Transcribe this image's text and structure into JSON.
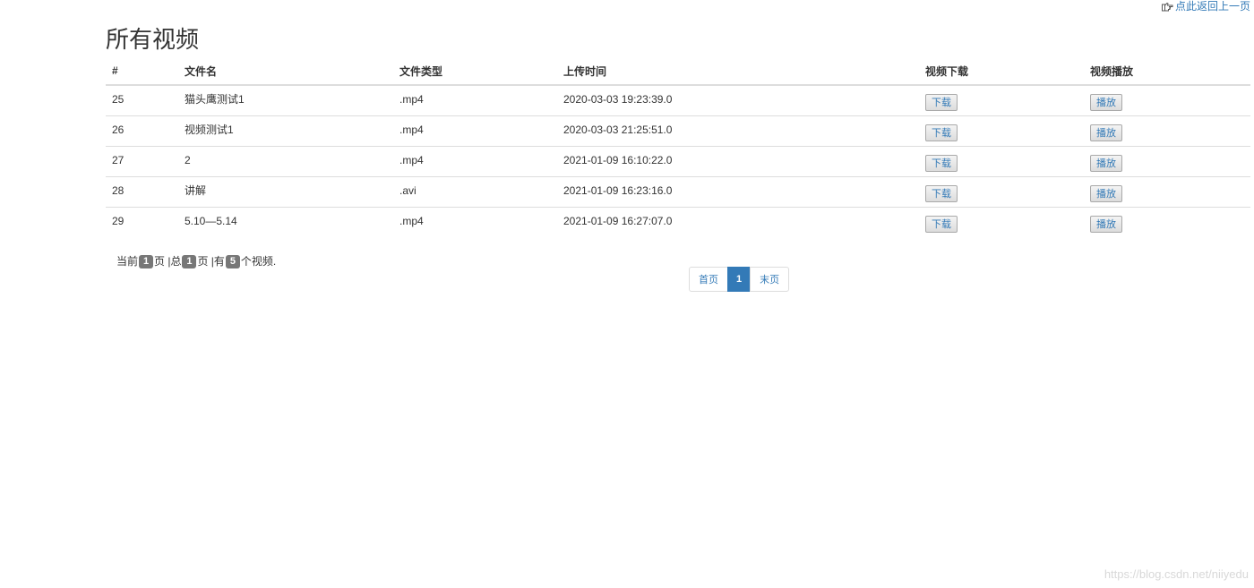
{
  "header": {
    "back_link": "点此返回上一页",
    "title": "所有视频"
  },
  "table": {
    "columns": [
      "#",
      "文件名",
      "文件类型",
      "上传时间",
      "视频下载",
      "视频播放"
    ],
    "rows": [
      {
        "id": "25",
        "name": "猫头鹰测试1",
        "type": ".mp4",
        "uploaded": "2020-03-03 19:23:39.0",
        "download": "下载",
        "play": "播放"
      },
      {
        "id": "26",
        "name": "视频测试1",
        "type": ".mp4",
        "uploaded": "2020-03-03 21:25:51.0",
        "download": "下载",
        "play": "播放"
      },
      {
        "id": "27",
        "name": "2",
        "type": ".mp4",
        "uploaded": "2021-01-09 16:10:22.0",
        "download": "下载",
        "play": "播放"
      },
      {
        "id": "28",
        "name": "讲解",
        "type": ".avi",
        "uploaded": "2021-01-09 16:23:16.0",
        "download": "下载",
        "play": "播放"
      },
      {
        "id": "29",
        "name": "5.10—5.14",
        "type": ".mp4",
        "uploaded": "2021-01-09 16:27:07.0",
        "download": "下载",
        "play": "播放"
      }
    ]
  },
  "summary": {
    "current_prefix": "当前",
    "current_page": "1",
    "current_suffix": "页 |总",
    "total_pages": "1",
    "total_suffix": "页 |有",
    "total_videos": "5",
    "videos_suffix": "个视频."
  },
  "pagination": {
    "first": "首页",
    "current": "1",
    "last": "末页"
  },
  "watermark": "https://blog.csdn.net/niiyedu",
  "colors": {
    "link": "#337ab7",
    "badge": "#777777",
    "border": "#dddddd"
  }
}
